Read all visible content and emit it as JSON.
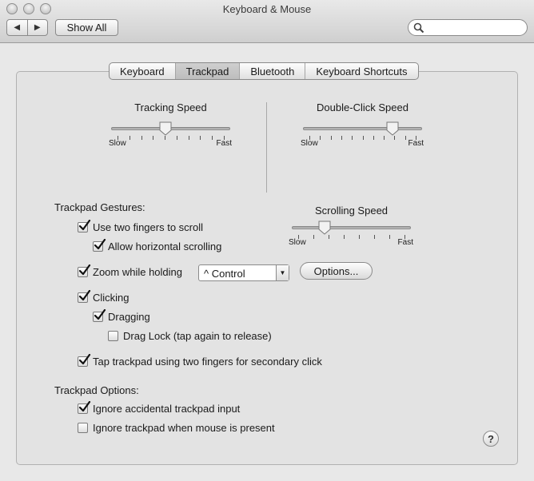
{
  "window": {
    "title": "Keyboard & Mouse"
  },
  "toolbar": {
    "back_icon": "back-arrow-icon",
    "forward_icon": "forward-arrow-icon",
    "show_all_label": "Show All",
    "search": {
      "value": "",
      "placeholder": ""
    }
  },
  "tabs": [
    {
      "label": "Keyboard",
      "selected": false
    },
    {
      "label": "Trackpad",
      "selected": true
    },
    {
      "label": "Bluetooth",
      "selected": false
    },
    {
      "label": "Keyboard Shortcuts",
      "selected": false
    }
  ],
  "tracking_speed": {
    "title": "Tracking Speed",
    "min_label": "Slow",
    "max_label": "Fast",
    "value": 0.45,
    "ticks": 10
  },
  "double_click_speed": {
    "title": "Double-Click Speed",
    "min_label": "Slow",
    "max_label": "Fast",
    "value": 0.78,
    "ticks": 11
  },
  "gestures": {
    "title": "Trackpad Gestures:",
    "two_finger_scroll": {
      "label": "Use two fingers to scroll",
      "checked": true
    },
    "horizontal_scroll": {
      "label": "Allow horizontal scrolling",
      "checked": true
    },
    "zoom": {
      "label": "Zoom while holding",
      "checked": true,
      "modifier_value": "^ Control",
      "options_label": "Options..."
    },
    "clicking": {
      "label": "Clicking",
      "checked": true
    },
    "dragging": {
      "label": "Dragging",
      "checked": true
    },
    "drag_lock": {
      "label": "Drag Lock (tap again to release)",
      "checked": false
    },
    "secondary_click": {
      "label": "Tap trackpad using two fingers for secondary click",
      "checked": true
    }
  },
  "scrolling_speed": {
    "title": "Scrolling Speed",
    "min_label": "Slow",
    "max_label": "Fast",
    "value": 0.25,
    "ticks": 8
  },
  "options": {
    "title": "Trackpad Options:",
    "ignore_accidental": {
      "label": "Ignore accidental trackpad input",
      "checked": true
    },
    "ignore_when_mouse": {
      "label": "Ignore trackpad when mouse is present",
      "checked": false
    }
  },
  "help_label": "?"
}
